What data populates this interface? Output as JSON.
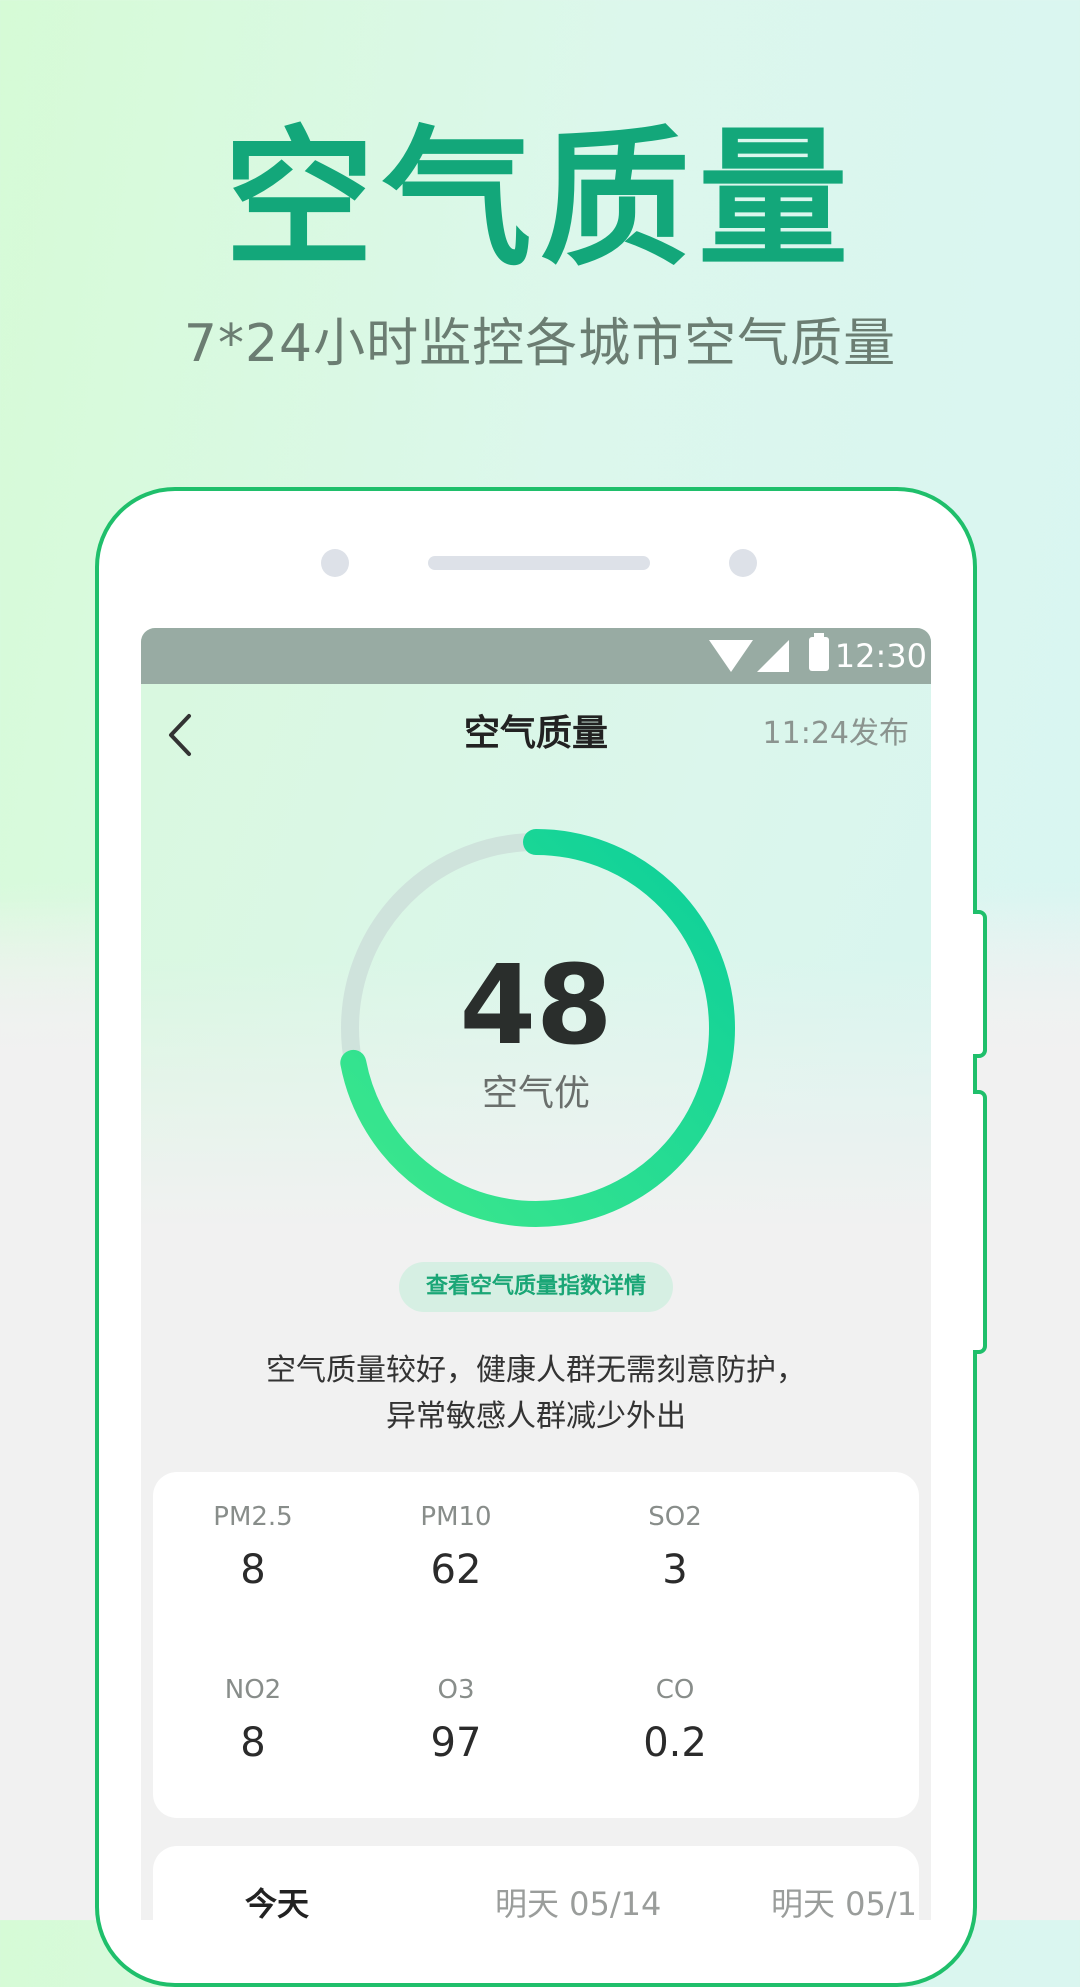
{
  "hero": {
    "title": "空气质量",
    "subtitle": "7*24小时监控各城市空气质量"
  },
  "status_bar": {
    "time": "12:30",
    "icons": [
      "wifi-icon",
      "signal-icon",
      "battery-icon"
    ]
  },
  "nav": {
    "back_icon": "chevron-left-icon",
    "title": "空气质量",
    "publish_time": "11:24发布"
  },
  "aqi": {
    "value": "48",
    "level": "空气优",
    "progress_fraction": 0.72
  },
  "detail_button": "查看空气质量指数详情",
  "advice": {
    "line1": "空气质量较好，健康人群无需刻意防护，",
    "line2": "异常敏感人群减少外出"
  },
  "pollutants": [
    {
      "name": "PM2.5",
      "value": "8"
    },
    {
      "name": "PM10",
      "value": "62"
    },
    {
      "name": "SO2",
      "value": "3"
    },
    {
      "name": "NO2",
      "value": "8"
    },
    {
      "name": "O3",
      "value": "97"
    },
    {
      "name": "CO",
      "value": "0.2"
    }
  ],
  "forecast_tabs": [
    {
      "label": "今天"
    },
    {
      "label": "明天 05/14"
    },
    {
      "label": "明天 05/1"
    }
  ],
  "colors": {
    "accent": "#13a77a",
    "frame": "#1fbf6b",
    "gauge_start": "#3ee88c",
    "gauge_end": "#0ccf9a",
    "gauge_track": "#cfe3dc"
  }
}
